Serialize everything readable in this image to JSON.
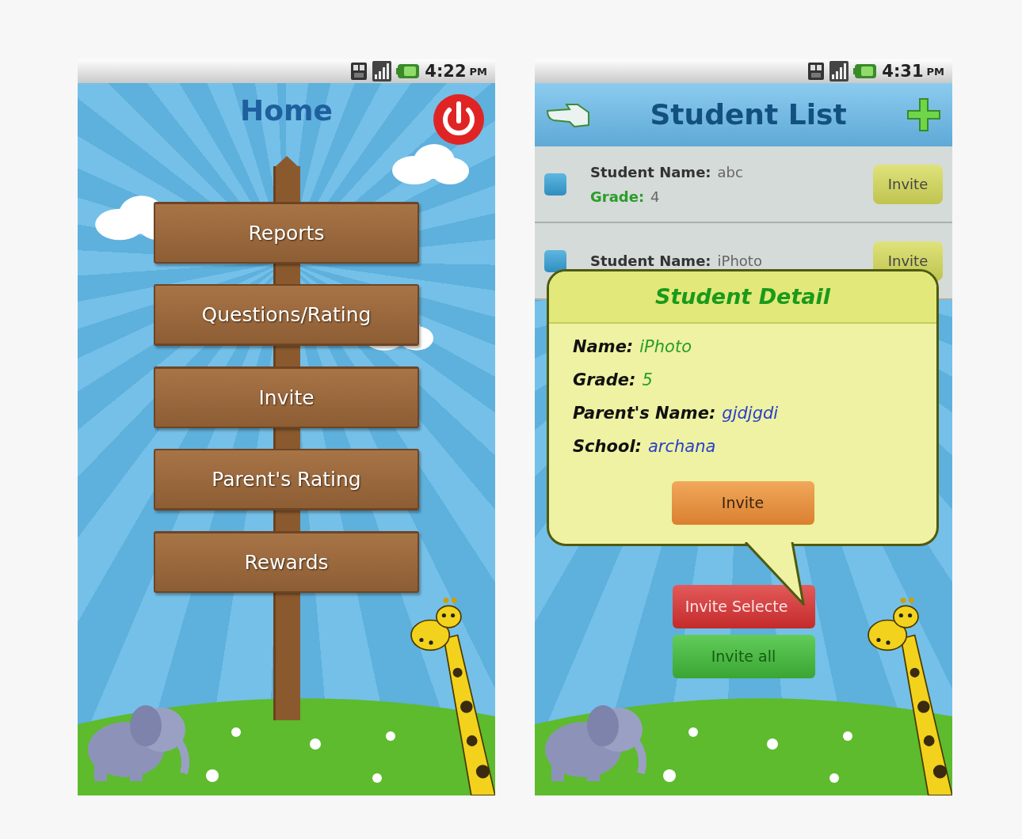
{
  "screens": [
    {
      "kind": "home",
      "status_bar": {
        "time": "4:22",
        "meridiem": "PM"
      },
      "title": "Home",
      "menu": [
        "Reports",
        "Questions/Rating",
        "Invite",
        "Parent's Rating",
        "Rewards"
      ]
    },
    {
      "kind": "student_list",
      "status_bar": {
        "time": "4:31",
        "meridiem": "PM"
      },
      "title": "Student List",
      "students": [
        {
          "name_label": "Student Name:",
          "name": "abc",
          "grade_label": "Grade:",
          "grade": "4",
          "checked": false,
          "button": "Invite"
        },
        {
          "name_label": "Student Name:",
          "name": "iPhoto",
          "checked": false,
          "button": "Invite"
        }
      ],
      "detail": {
        "title": "Student Detail",
        "fields": [
          {
            "label": "Name:",
            "value": "iPhoto",
            "color": "#2a9d2a"
          },
          {
            "label": "Grade:",
            "value": "5",
            "color": "#2a9d2a"
          },
          {
            "label": "Parent's Name:",
            "value": "gjdjgdi",
            "color": "#2a3fc8"
          },
          {
            "label": "School:",
            "value": "archana",
            "color": "#2a3fc8"
          }
        ],
        "button": "Invite"
      },
      "actions": [
        {
          "label": "Invite Selecte",
          "kind": "danger"
        },
        {
          "label": "Invite all",
          "kind": "success"
        }
      ]
    }
  ]
}
